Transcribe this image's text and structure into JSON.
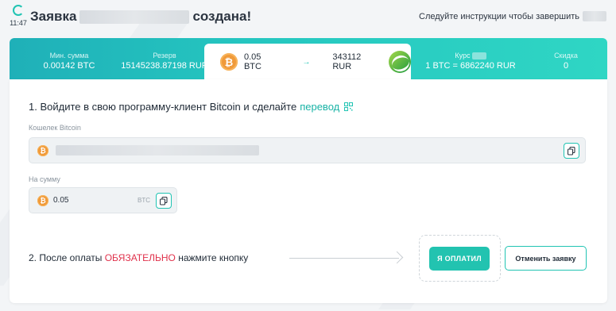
{
  "header": {
    "timer": "11:47",
    "title_prefix": "Заявка",
    "title_suffix": "создана!",
    "instruction": "Следуйте инструкции чтобы завершить"
  },
  "stats": {
    "min_sum_label": "Мин. сумма",
    "min_sum_value": "0.00142 BTC",
    "reserve_label": "Резерв",
    "reserve_value": "15145238.87198 RUR",
    "rate_label": "Курс",
    "rate_value": "1 BTC = 6862240 RUR",
    "discount_label": "Скидка",
    "discount_value": "0"
  },
  "exchange": {
    "from_amount": "0.05 BTC",
    "arrow": "→",
    "to_amount": "343112 RUR",
    "from_icon": "bitcoin-icon",
    "to_icon": "sberbank-icon"
  },
  "step1": {
    "text": "1. Войдите в свою программу-клиент Bitcoin и сделайте",
    "link": "перевод"
  },
  "wallet": {
    "label": "Кошелек Bitcoin"
  },
  "amount": {
    "label": "На сумму",
    "value": "0.05",
    "unit": "BTC"
  },
  "step2": {
    "before": "2. После оплаты",
    "emphasis": "ОБЯЗАТЕЛЬНО",
    "after": "нажмите кнопку"
  },
  "buttons": {
    "paid": "Я ОПЛАТИЛ",
    "cancel": "Отменить заявку"
  },
  "colors": {
    "accent": "#22c3b0",
    "bitcoin": "#f09a3a",
    "warning": "#e0314b"
  }
}
